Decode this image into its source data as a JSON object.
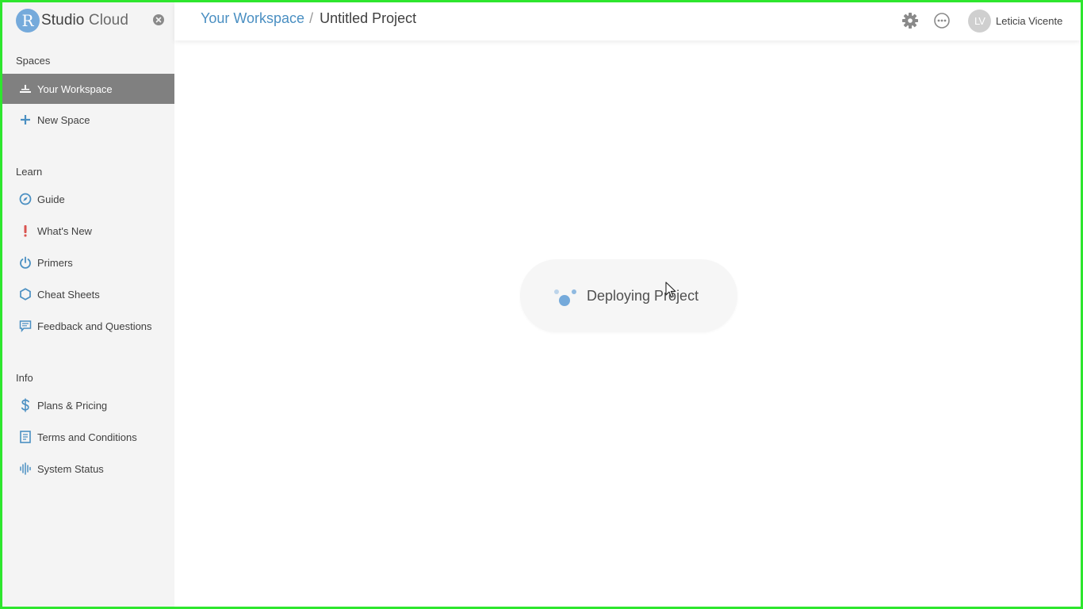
{
  "brand": {
    "logo_letter": "R",
    "name_bold": "Studio",
    "name_light": "Cloud"
  },
  "sidebar": {
    "sections": {
      "spaces": "Spaces",
      "learn": "Learn",
      "info": "Info"
    },
    "spaces": [
      {
        "label": "Your Workspace",
        "icon": "workspace-icon",
        "active": true
      },
      {
        "label": "New Space",
        "icon": "plus-icon"
      }
    ],
    "learn": [
      {
        "label": "Guide",
        "icon": "compass-icon"
      },
      {
        "label": "What's New",
        "icon": "exclamation-icon"
      },
      {
        "label": "Primers",
        "icon": "power-icon"
      },
      {
        "label": "Cheat Sheets",
        "icon": "hexagon-icon"
      },
      {
        "label": "Feedback and Questions",
        "icon": "comment-icon"
      }
    ],
    "info": [
      {
        "label": "Plans & Pricing",
        "icon": "dollar-icon"
      },
      {
        "label": "Terms and Conditions",
        "icon": "document-icon"
      },
      {
        "label": "System Status",
        "icon": "signal-bars-icon"
      }
    ]
  },
  "header": {
    "breadcrumb_workspace": "Your Workspace",
    "breadcrumb_separator": "/",
    "breadcrumb_project": "Untitled Project",
    "user_initials": "LV",
    "user_name": "Leticia Vicente"
  },
  "main": {
    "status_text": "Deploying Project"
  },
  "colors": {
    "accent": "#75aadb",
    "link": "#4a8fc2",
    "active_nav": "#808080",
    "sidebar_bg": "#f4f4f4",
    "alert": "#d9534f",
    "frame": "#2ee62e"
  }
}
